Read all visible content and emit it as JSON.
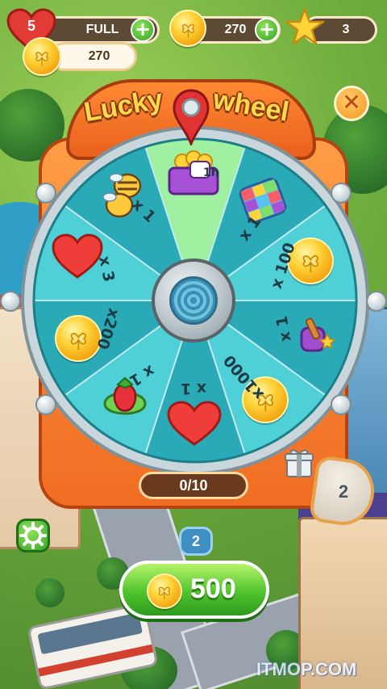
{
  "hud": {
    "lives": "5",
    "lives_status": "FULL",
    "coins": "270",
    "stars": "3",
    "coin_balance": "270"
  },
  "wheel": {
    "title_left": "Lucky",
    "title_right": "wheel",
    "progress": "0/10",
    "prizes": [
      {
        "name": "booster-box",
        "label": "1h"
      },
      {
        "name": "cube-booster",
        "label": "x 1"
      },
      {
        "name": "coins",
        "label": "x 100"
      },
      {
        "name": "hammer-booster",
        "label": "x 1"
      },
      {
        "name": "coins-large",
        "label": "x1000"
      },
      {
        "name": "heart",
        "label": "x 1"
      },
      {
        "name": "strawberry-booster",
        "label": "x 1"
      },
      {
        "name": "coins-medium",
        "label": "x200"
      },
      {
        "name": "heart-multi",
        "label": "x 3"
      },
      {
        "name": "bee-booster",
        "label": "x 1"
      }
    ]
  },
  "spin_button": {
    "price": "500"
  },
  "map": {
    "level_badge_large": "2",
    "level_badge_small": "2"
  },
  "watermark": "ITMOP.COM",
  "colors": {
    "wheel_teal_light": "#4fd0d6",
    "wheel_teal_dark": "#2aa9b6",
    "wheel_highlight": "#9ff0a0",
    "panel_orange": "#f5792a",
    "title_yellow": "#ffd94d",
    "spin_green": "#4fc42d"
  },
  "icons": {
    "pointer": "map-pin-icon",
    "close": "close-icon",
    "gift": "gift-icon",
    "settings": "gear-icon"
  }
}
